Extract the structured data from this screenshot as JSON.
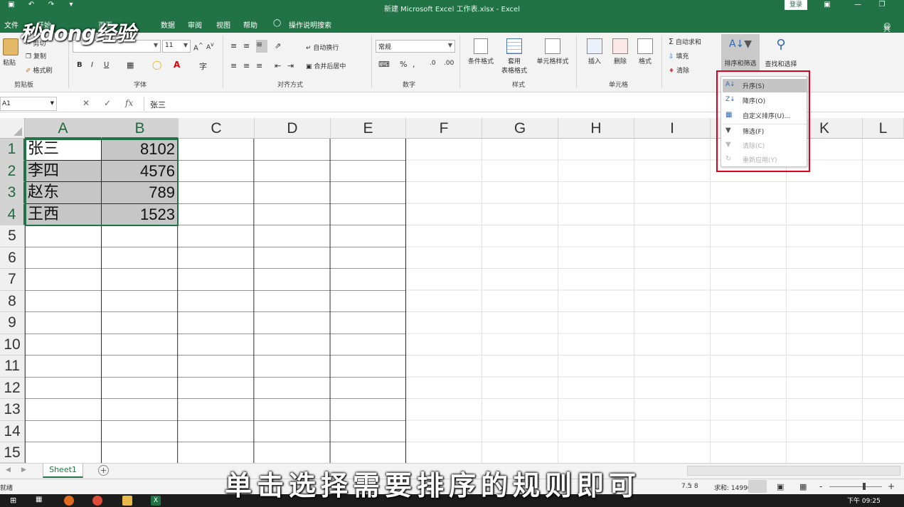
{
  "window": {
    "title": "新建 Microsoft Excel 工作表.xlsx  -  Excel",
    "login": "登录",
    "share": "共"
  },
  "watermark": "秒dong经验",
  "tabs": [
    "文件",
    "开始",
    "页面",
    "数据",
    "审阅",
    "视图",
    "帮助",
    "操作说明搜索"
  ],
  "ribbon": {
    "clipboard": {
      "label": "剪贴板",
      "paste": "粘贴",
      "cut": "剪切",
      "copy": "复制",
      "format_painter": "格式刷"
    },
    "font": {
      "label": "字体",
      "font_size": "11",
      "bold": "B",
      "italic": "I",
      "underline": "U"
    },
    "alignment": {
      "label": "对齐方式",
      "wrap": "自动换行",
      "merge": "合并后居中"
    },
    "number": {
      "label": "数字",
      "format": "常规",
      "percent": "%"
    },
    "styles": {
      "label": "样式",
      "conditional": "条件格式",
      "table_line1": "套用",
      "table_line2": "表格格式",
      "cell_styles": "单元格样式"
    },
    "cells": {
      "label": "单元格",
      "insert": "插入",
      "delete": "删除",
      "format": "格式"
    },
    "editing": {
      "autosum": "自动求和",
      "fill": "填充",
      "clear": "清除",
      "sort_filter": "排序和筛选",
      "find_select": "查找和选择"
    }
  },
  "formula_bar": {
    "name_box": "A1",
    "fx": "fx",
    "content": "张三"
  },
  "columns": [
    "A",
    "B",
    "C",
    "D",
    "E",
    "F",
    "G",
    "H",
    "I",
    "J",
    "K",
    "L"
  ],
  "rows": [
    "1",
    "2",
    "3",
    "4",
    "5",
    "6",
    "7",
    "8",
    "9",
    "10",
    "11",
    "12",
    "13",
    "14",
    "15"
  ],
  "data_cells": [
    {
      "name": "张三",
      "value": "8102"
    },
    {
      "name": "李四",
      "value": "4576"
    },
    {
      "name": "赵东",
      "value": "789"
    },
    {
      "name": "王西",
      "value": "1523"
    }
  ],
  "sort_menu": {
    "items": [
      {
        "label": "升序(S)",
        "state": "highlighted"
      },
      {
        "label": "降序(O)",
        "state": "enabled"
      },
      {
        "label": "自定义排序(U)...",
        "state": "enabled"
      },
      {
        "label": "筛选(F)",
        "state": "enabled"
      },
      {
        "label": "清除(C)",
        "state": "disabled"
      },
      {
        "label": "重新应用(Y)",
        "state": "disabled"
      }
    ]
  },
  "sheets": {
    "active": "Sheet1"
  },
  "status": {
    "left": "就绪",
    "count_partial": "7.5",
    "count": ": 8",
    "sum": "求和: 14990",
    "zoom_minus": "-",
    "zoom_plus": "+"
  },
  "subtitle": "单击选择需要排序的规则即可",
  "taskbar": {
    "time": "下午 09:25"
  },
  "colors": {
    "excel_green": "#217346",
    "highlight_red": "#e0001b",
    "selected_fill": "#c6c6c6"
  }
}
